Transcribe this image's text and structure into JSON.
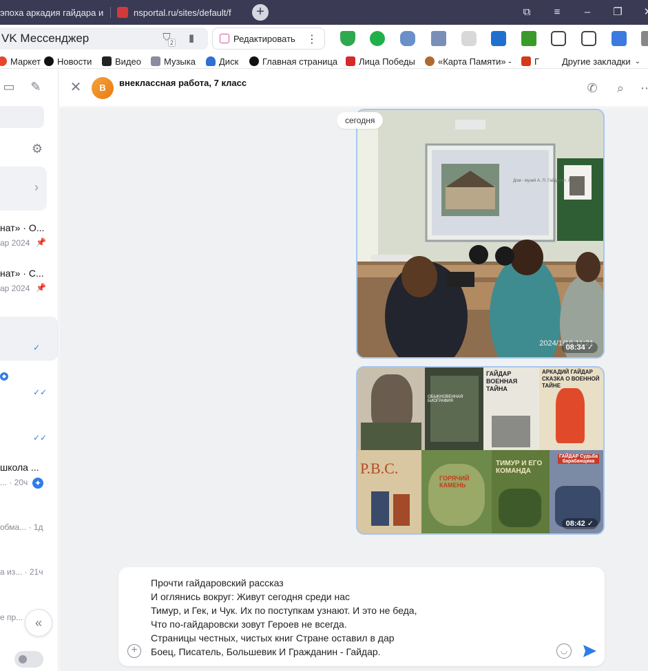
{
  "browser": {
    "tabs": [
      {
        "title": "эпоха аркадия гайдара и"
      },
      {
        "title": "nsportal.ru/sites/default/f"
      }
    ],
    "address": {
      "title": "VK Мессенджер",
      "notification_count": "2",
      "edit_label": "Редактировать"
    },
    "bookmarks": [
      {
        "label": "Маркет"
      },
      {
        "label": "Новости"
      },
      {
        "label": "Видео"
      },
      {
        "label": "Музыка"
      },
      {
        "label": "Диск"
      },
      {
        "label": "Главная страница"
      },
      {
        "label": "Лица Победы"
      },
      {
        "label": "«Карта Памяти» -"
      },
      {
        "label": "Г"
      },
      {
        "label": "Другие закладки"
      }
    ]
  },
  "sidebar": {
    "chats": [
      {
        "name": "нат» · О...",
        "sub": "ар 2024"
      },
      {
        "name": "нат» · С...",
        "sub": "ар 2024"
      },
      {
        "name": "",
        "sub": ""
      },
      {
        "name": "",
        "sub": ""
      },
      {
        "name": "",
        "sub": ""
      },
      {
        "name": "школа ...",
        "sub": "... · 20ч"
      },
      {
        "name": "",
        "sub": "обма... · 1д"
      },
      {
        "name": "",
        "sub": "а из... · 21ч"
      },
      {
        "name": "",
        "sub": "е пр..."
      }
    ]
  },
  "chat": {
    "avatar_letter": "В",
    "title": "внеклассная работа, 7 класс",
    "date_chip": "сегодня",
    "messages": [
      {
        "time": "08:34",
        "photo_stamp": "2024/1/16 11:21",
        "slide_text": "Дом - музей А. П. Гайдара г. Льгов"
      },
      {
        "time": "08:42",
        "books": [
          "ОБЫКНОВЕННАЯ БИОГРАФИЯ",
          "ГАЙДАР ВОЕННАЯ ТАЙНА",
          "АРКАДИЙ ГАЙДАР СКАЗКА О ВОЕННОЙ ТАЙНЕ",
          "Р.В.С.",
          "ГОРЯЧИЙ КАМЕНЬ",
          "ТИМУР И ЕГО КОМАНДА",
          "ГАЙДАР Судьба барабанщика"
        ]
      }
    ]
  },
  "composer": {
    "lines": [
      "Прочти гайдаровский рассказ",
      "И оглянись вокруг: Живут сегодня среди нас",
      "Тимур, и Гек, и Чук. Их по поступкам узнают. И это не беда,",
      "Что по-гайдаровски зовут Героев не всегда.",
      "Страницы честных, чистых книг Стране оставил в дар",
      "Боец, Писатель, Большевик И Гражданин - Гайдар."
    ]
  }
}
